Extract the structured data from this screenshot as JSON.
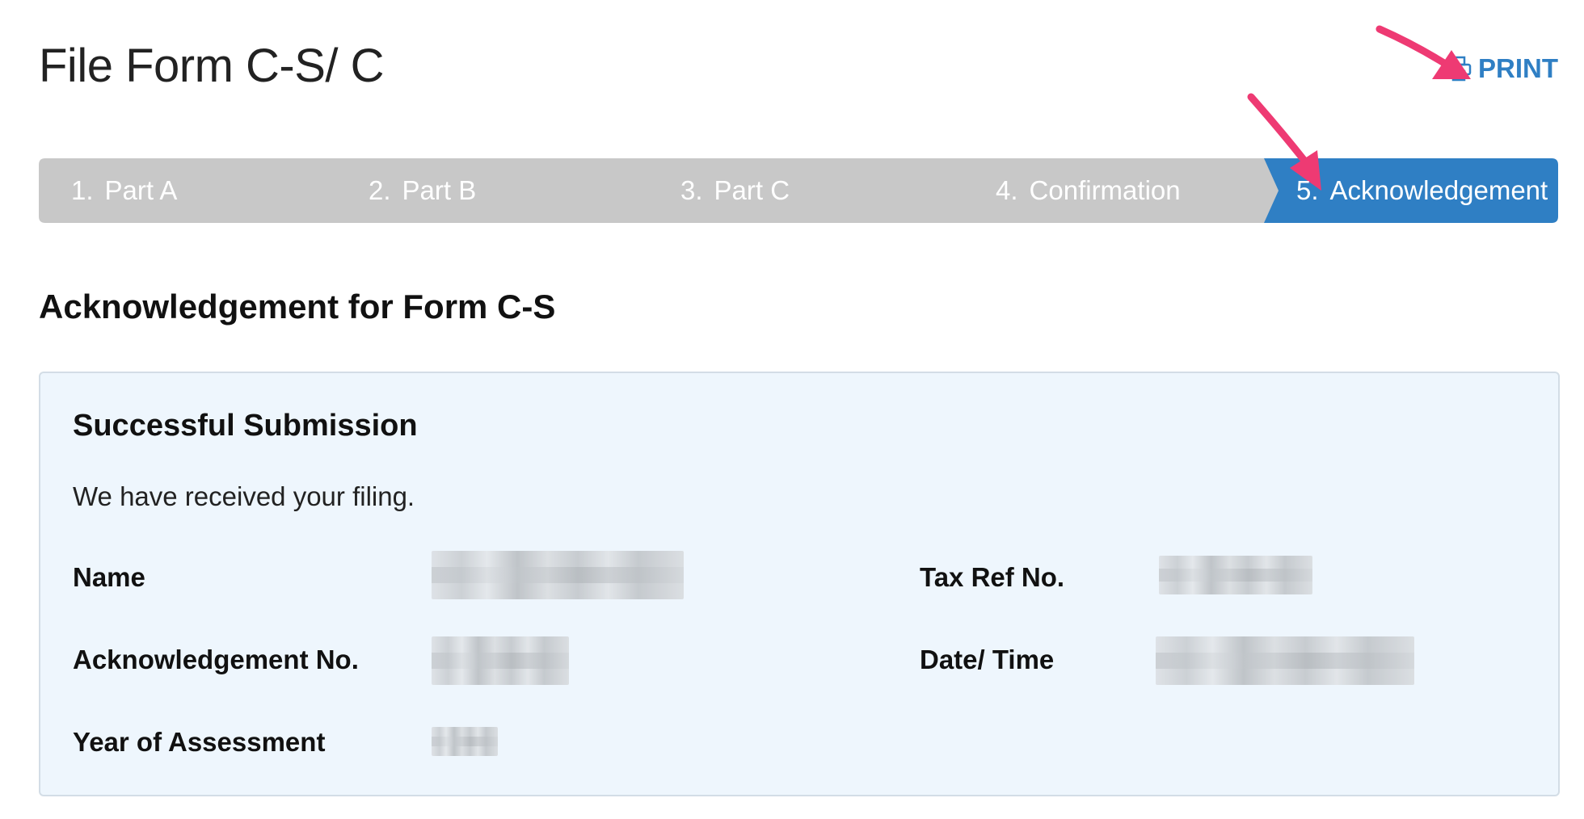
{
  "header": {
    "title": "File Form C-S/ C",
    "print_label": "PRINT",
    "print_icon": "printer-icon"
  },
  "colors": {
    "step_inactive": "#c8c8c8",
    "step_active": "#2f7fc4",
    "link": "#2f7fc4",
    "card_bg": "#eef6fd"
  },
  "stepper": {
    "active_index": 4,
    "steps": [
      {
        "num": "1.",
        "label": "Part A"
      },
      {
        "num": "2.",
        "label": "Part B"
      },
      {
        "num": "3.",
        "label": "Part C"
      },
      {
        "num": "4.",
        "label": "Confirmation"
      },
      {
        "num": "5.",
        "label": "Acknowledgement"
      }
    ]
  },
  "section": {
    "title": "Acknowledgement for Form C-S"
  },
  "card": {
    "title": "Successful Submission",
    "message": "We have received your filing.",
    "fields": {
      "name_label": "Name",
      "ack_no_label": "Acknowledgement No.",
      "ya_label": "Year of Assessment",
      "tax_ref_label": "Tax Ref No.",
      "datetime_label": "Date/ Time"
    }
  }
}
